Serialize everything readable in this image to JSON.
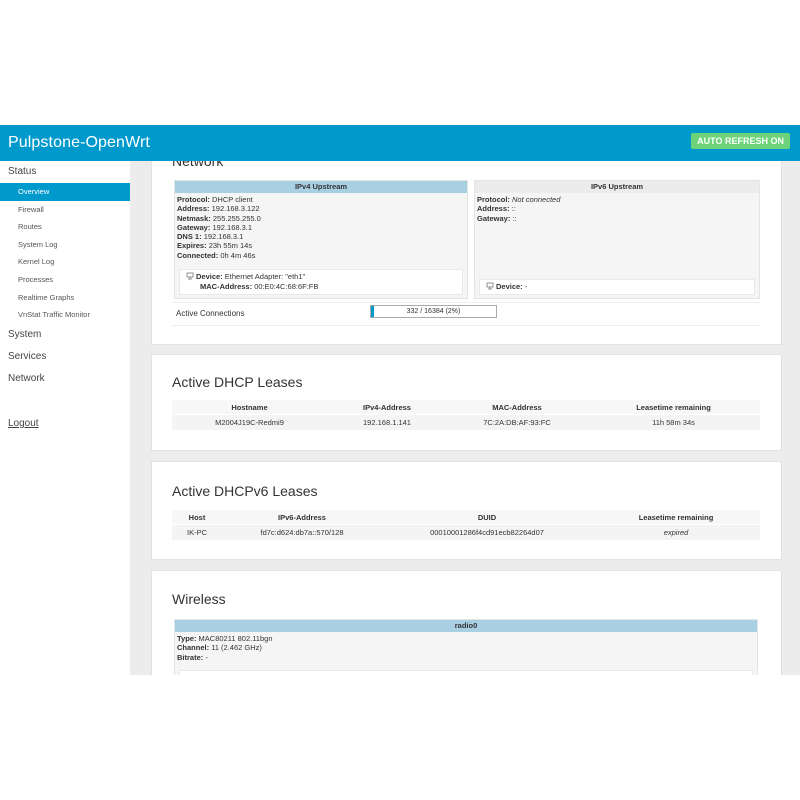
{
  "header": {
    "brand": "Pulpstone-OpenWrt",
    "auto_refresh": "AUTO REFRESH ON"
  },
  "sidebar": {
    "status_label": "Status",
    "status_items": [
      "Overview",
      "Firewall",
      "Routes",
      "System Log",
      "Kernel Log",
      "Processes",
      "Realtime Graphs",
      "VnStat Traffic Monitor"
    ],
    "active_item": "Overview",
    "groups": [
      "System",
      "Services",
      "Network"
    ],
    "logout": "Logout"
  },
  "network": {
    "title": "Network",
    "ipv4": {
      "header": "IPv4 Upstream",
      "lines": [
        {
          "k": "Protocol:",
          "v": "DHCP client"
        },
        {
          "k": "Address:",
          "v": "192.168.3.122"
        },
        {
          "k": "Netmask:",
          "v": "255.255.255.0"
        },
        {
          "k": "Gateway:",
          "v": "192.168.3.1"
        },
        {
          "k": "DNS 1:",
          "v": "192.168.3.1"
        },
        {
          "k": "Expires:",
          "v": "23h 55m 14s"
        },
        {
          "k": "Connected:",
          "v": "0h 4m 46s"
        }
      ],
      "device_label": "Device:",
      "device_value": "Ethernet Adapter: \"eth1\"",
      "mac_label": "MAC-Address:",
      "mac_value": "00:E0:4C:68:6F:FB"
    },
    "ipv6": {
      "header": "IPv6 Upstream",
      "protocol_label": "Protocol:",
      "protocol_value": "Not connected",
      "address_label": "Address:",
      "address_value": "::",
      "gateway_label": "Gateway:",
      "gateway_value": "::",
      "device_label": "Device:",
      "device_value": "-"
    },
    "active_connections": {
      "label": "Active Connections",
      "text": "332 / 16384 (2%)",
      "fraction": 0.02
    }
  },
  "dhcp": {
    "title": "Active DHCP Leases",
    "columns": [
      "Hostname",
      "IPv4-Address",
      "MAC-Address",
      "Leasetime remaining"
    ],
    "rows": [
      [
        "M2004J19C-Redmi9",
        "192.168.1.141",
        "7C:2A:DB:AF:93:FC",
        "11h 58m 34s"
      ]
    ]
  },
  "dhcp6": {
    "title": "Active DHCPv6 Leases",
    "columns": [
      "Host",
      "IPv6-Address",
      "DUID",
      "Leasetime remaining"
    ],
    "rows": [
      [
        "IK-PC",
        "fd7c:d624:db7a::570/128",
        "00010001286f4cd91ecb82264d07",
        "expired"
      ]
    ]
  },
  "wireless": {
    "title": "Wireless",
    "radio": "radio0",
    "lines": [
      {
        "k": "Type:",
        "v": "MAC80211 802.11bgn"
      },
      {
        "k": "Channel:",
        "v": "11 (2.462 GHz)"
      },
      {
        "k": "Bitrate:",
        "v": "-"
      }
    ]
  },
  "colors": {
    "accent": "#0099cc",
    "auto_refresh": "#6cd37a",
    "ipv4_header": "#a9cfe3",
    "wireless_header": "#a9cfe3"
  }
}
